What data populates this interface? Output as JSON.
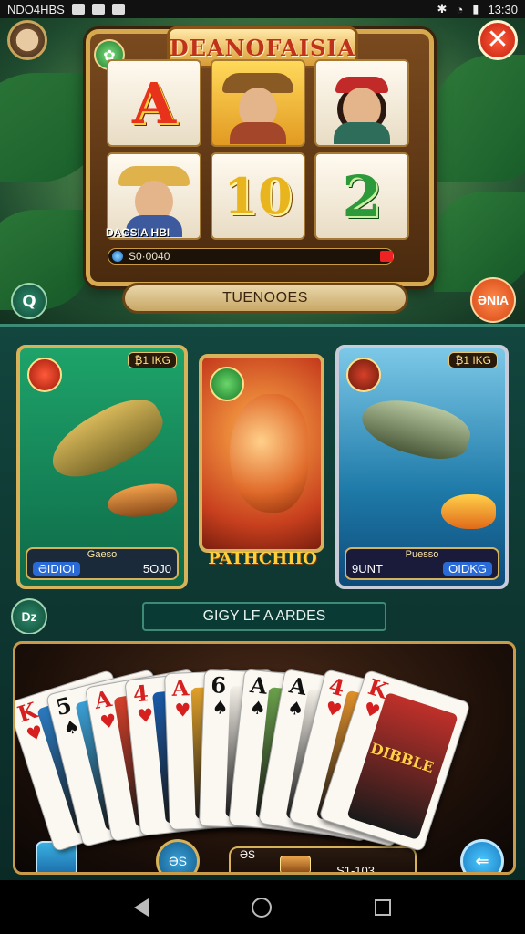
{
  "status_bar": {
    "carrier": "NDO4HBS",
    "time": "13:30"
  },
  "slot": {
    "title": "DEANOFAISIA",
    "reels": [
      "A",
      "10",
      "2"
    ],
    "name_tag": "DAGSIA HBI",
    "coin_value": "S0·0040",
    "banner": "TUENOOES",
    "left_button": "Q",
    "right_button": "ƏNIA"
  },
  "fish_cards": {
    "left": {
      "tag": "₿1 IKG",
      "footer_label": "Gaeso",
      "left_value": "ƏIDIOI",
      "right_value": "5OJ0"
    },
    "middle": {
      "title": "PATHCHIIO"
    },
    "right": {
      "tag": "₿1 IKG",
      "footer_label": "Puesso",
      "left_value": "9UNT",
      "right_value": "OIDKG"
    }
  },
  "section": {
    "left_button": "Dz",
    "title": "GIGY LF A ARDES"
  },
  "cards": {
    "hand": [
      {
        "rank": "K",
        "suit": "♥",
        "color": "red"
      },
      {
        "rank": "5",
        "suit": "♠",
        "color": "black"
      },
      {
        "rank": "A",
        "suit": "♥",
        "color": "red"
      },
      {
        "rank": "4",
        "suit": "♥",
        "color": "red"
      },
      {
        "rank": "A",
        "suit": "♥",
        "color": "red"
      },
      {
        "rank": "6",
        "suit": "♠",
        "color": "black"
      },
      {
        "rank": "A",
        "suit": "♠",
        "color": "black"
      },
      {
        "rank": "A",
        "suit": "♠",
        "color": "black"
      },
      {
        "rank": "4",
        "suit": "♥",
        "color": "red"
      },
      {
        "rank": "K",
        "suit": "♥",
        "color": "red"
      }
    ],
    "featured_card_text": "DIBBLE",
    "footer_small": "ƏS",
    "footer_value": "S1-103",
    "ring_label": "ƏS"
  }
}
